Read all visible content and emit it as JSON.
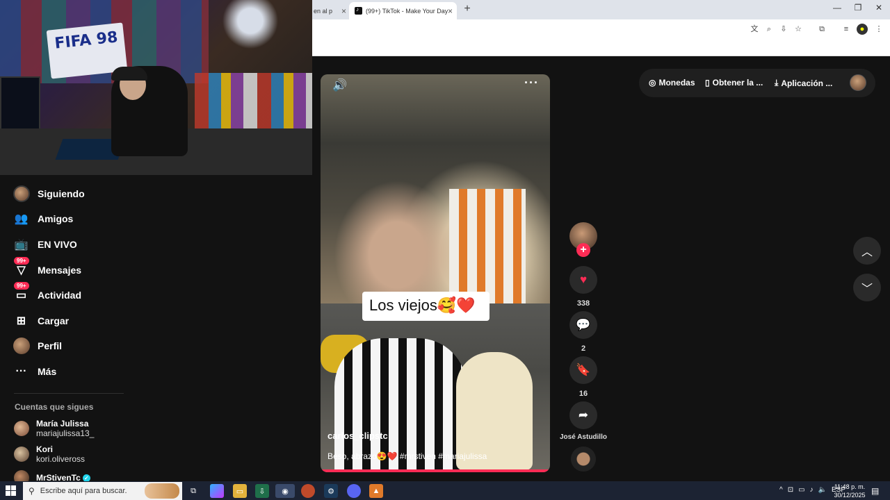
{
  "browser": {
    "prev_tab_label": "en al p",
    "active_tab_label": "(99+) TikTok - Make Your Day",
    "new_tab": "+",
    "window_controls": [
      "—",
      "❐",
      "✕"
    ]
  },
  "sidebar": {
    "items": [
      {
        "label": "Siguiendo",
        "icon": "avatar-icon"
      },
      {
        "label": "Amigos",
        "icon": "friends-icon"
      },
      {
        "label": "EN VIVO",
        "icon": "live-icon"
      },
      {
        "label": "Mensajes",
        "icon": "messages-icon",
        "badge": "99+"
      },
      {
        "label": "Actividad",
        "icon": "activity-icon",
        "badge": "99+"
      },
      {
        "label": "Cargar",
        "icon": "upload-icon"
      },
      {
        "label": "Perfil",
        "icon": "profile-avatar-icon"
      },
      {
        "label": "Más",
        "icon": "more-icon"
      }
    ],
    "following_heading": "Cuentas que sigues",
    "accounts": [
      {
        "name": "María Julissa",
        "handle": "mariajulissa13_"
      },
      {
        "name": "Kori",
        "handle": "kori.oliveross"
      },
      {
        "name": "MrStivenTc",
        "handle": "",
        "verified": true
      }
    ]
  },
  "video": {
    "caption_text": "Los viejos🥰❤️",
    "author": "carlos_clipstc",
    "description": "Beso, abrazo😍❤️ #mrstiven #mariajulissa"
  },
  "actions": {
    "likes": "338",
    "comments": "2",
    "saves": "16",
    "sound_author": "José Astudillo"
  },
  "topbar": {
    "coins": "Monedas",
    "get_app": "Obtener la ...",
    "app": "Aplicación ..."
  },
  "taskbar": {
    "search_placeholder": "Escribe aquí para buscar.",
    "language": "ESP",
    "time": "11:48 p. m.",
    "date": "30/12/2025"
  },
  "webcam": {
    "poster_text": "FIFA 98"
  },
  "colors": {
    "accent": "#fe2c55",
    "verified": "#20d5ec",
    "background": "#121212"
  }
}
